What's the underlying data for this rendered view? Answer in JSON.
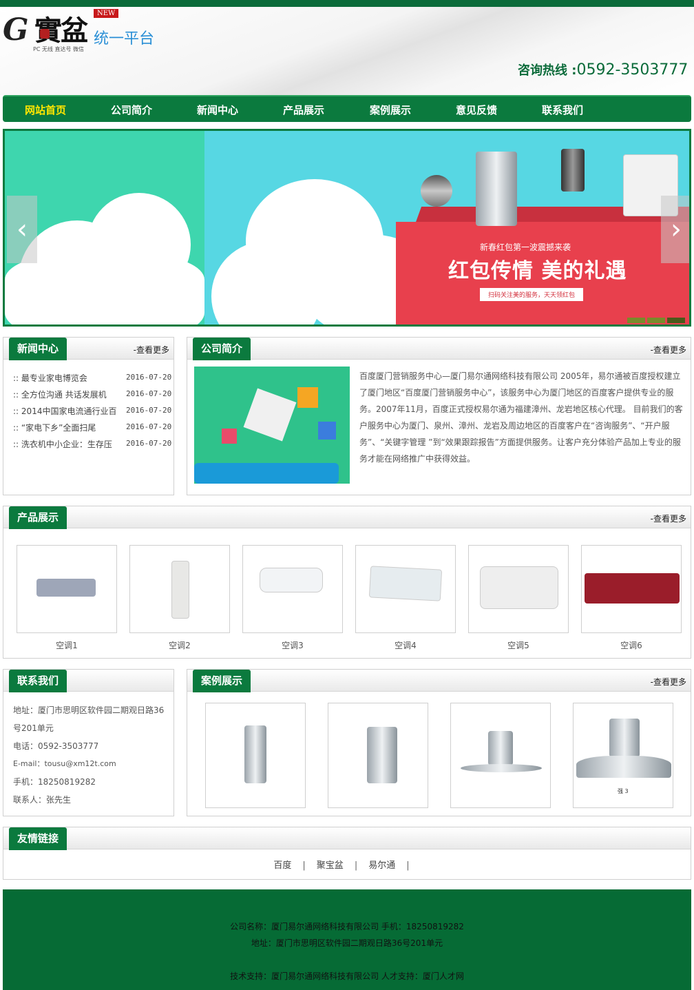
{
  "header": {
    "logo_letter": "G",
    "logo_name": "實盆",
    "logo_badge": "NEW",
    "logo_platform": "统一平台",
    "logo_sub": "PC 无线  直达号  微信",
    "hotline_label": "咨询热线 :",
    "hotline_number": "0592-3503777"
  },
  "nav": {
    "items": [
      "网站首页",
      "公司简介",
      "新闻中心",
      "产品展示",
      "案例展示",
      "意见反馈",
      "联系我们"
    ],
    "active_index": 0
  },
  "banner": {
    "small_text": "新春红包第一波震撼来袭",
    "big_text": "红包传情  美的礼遇",
    "ribbon_text": "扫码关注美的服务，天天领红包",
    "prev_arrow": "‹",
    "next_arrow": "›",
    "slide_count": 3,
    "active_slide": 2
  },
  "news": {
    "title": "新闻中心",
    "more": "-查看更多",
    "items": [
      {
        "bullet": "::",
        "title": "最专业家电博览会",
        "date": "2016-07-20"
      },
      {
        "bullet": "::",
        "title": "全方位沟通 共话发展机",
        "date": "2016-07-20"
      },
      {
        "bullet": "::",
        "title": "2014中国家电流通行业百",
        "date": "2016-07-20"
      },
      {
        "bullet": "::",
        "title": "“家电下乡”全面扫尾",
        "date": "2016-07-20"
      },
      {
        "bullet": "::",
        "title": "洗衣机中小企业：生存压",
        "date": "2016-07-20"
      }
    ]
  },
  "intro": {
    "title": "公司简介",
    "more": "-查看更多",
    "text": "百度厦门营销服务中心—厦门易尔通网络科技有限公司 2005年，易尔通被百度授权建立了厦门地区“百度厦门营销服务中心”，该服务中心为厦门地区的百度客户提供专业的服务。2007年11月，百度正式授权易尔通为福建漳州、龙岩地区核心代理。 目前我们的客户服务中心为厦门、泉州、漳州、龙岩及周边地区的百度客户在“咨询服务”、“开户服务”、“关键字管理 ”到“效果跟踪报告”方面提供服务。让客户充分体验产品加上专业的服务才能在网络推广中获得效益。"
  },
  "products": {
    "title": "产品展示",
    "more": "-查看更多",
    "items": [
      {
        "label": "空调1",
        "color": "#9ea6b8"
      },
      {
        "label": "空调2",
        "color": "#e8e8e6"
      },
      {
        "label": "空调3",
        "color": "#f2f4f6"
      },
      {
        "label": "空调4",
        "color": "#e6ecef"
      },
      {
        "label": "空调5",
        "color": "#eeeeee"
      },
      {
        "label": "空调6",
        "color": "#9a1d2a"
      }
    ]
  },
  "contact": {
    "title": "联系我们",
    "lines": [
      "地址：厦门市思明区软件园二期观日路36",
      "号201单元",
      "电话：0592-3503777",
      "E-mail：tousu@xm12t.com",
      "手机：18250819282",
      "联系人：张先生"
    ]
  },
  "cases": {
    "title": "案例展示",
    "more": "-查看更多",
    "items": [
      {
        "name": "fridge-single"
      },
      {
        "name": "fridge-double"
      },
      {
        "name": "range-hood-1"
      },
      {
        "name": "range-hood-2",
        "caption": "强 3"
      }
    ]
  },
  "links": {
    "title": "友情链接",
    "items": [
      "百度",
      "聚宝盆",
      "易尔通"
    ],
    "separator": "|"
  },
  "footer": {
    "line1": "公司名称：厦门易尔通网络科技有限公司  手机：18250819282",
    "line2": "地址：厦门市思明区软件园二期观日路36号201单元",
    "line3": "技术支持：厦门易尔通网络科技有限公司  人才支持：厦门人才网"
  },
  "colors": {
    "brand_green": "#0b7a3e",
    "nav_active": "#ffe600",
    "banner_red": "#e8404d"
  }
}
